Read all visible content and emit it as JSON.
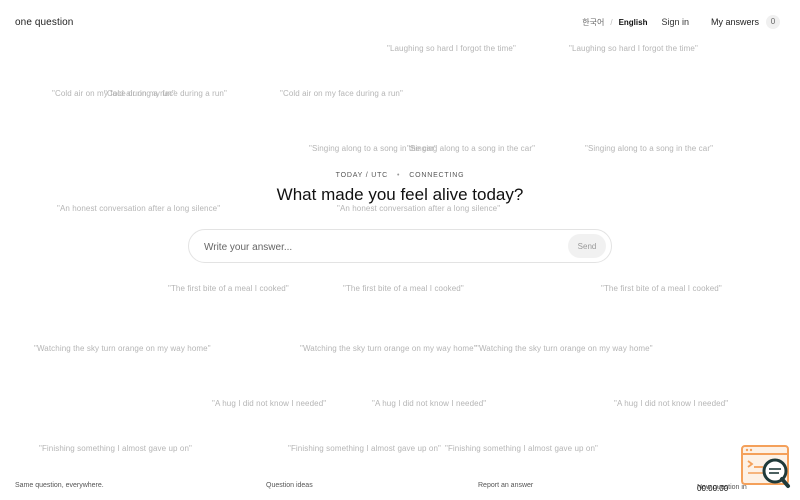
{
  "header": {
    "brand": "one question",
    "lang_alt": "한국어",
    "lang_current": "English",
    "sign_in": "Sign in",
    "my_answers": "My answers",
    "answers_count": "0"
  },
  "meta": {
    "date": "TODAY / UTC",
    "status": "CONNECTING"
  },
  "question": "What made you feel alive today?",
  "answer": {
    "placeholder": "Write your answer...",
    "send_label": "Send"
  },
  "floating_answers": [
    "\"Laughing so hard I forgot the time\"",
    "\"Laughing so hard I forgot the time\"",
    "\"Cold air on my face during a run\"",
    "\"Cold air on my face during a run\"",
    "\"Cold air on my face during a run\"",
    "\"Singing along to a song in the car\"",
    "\"Singing along to a song in the car\"",
    "\"Singing along to a song in the car\"",
    "\"An honest conversation after a long silence\"",
    "\"An honest conversation after a long silence\"",
    "\"The first bite of a meal I cooked\"",
    "\"The first bite of a meal I cooked\"",
    "\"The first bite of a meal I cooked\"",
    "\"Watching the sky turn orange on my way home\"",
    "\"Watching the sky turn orange on my way home\"",
    "\"Watching the sky turn orange on my way home\"",
    "\"A hug I did not know I needed\"",
    "\"A hug I did not know I needed\"",
    "\"A hug I did not know I needed\"",
    "\"Finishing something I almost gave up on\"",
    "\"Finishing something I almost gave up on\"",
    "\"Finishing something I almost gave up on\""
  ],
  "footer": {
    "tagline": "Same question, everywhere.",
    "ideas": "Question ideas",
    "report": "Report an answer",
    "next_question_label": "New question in",
    "timer": "00:00:00"
  },
  "icons": {
    "corner_widget": "browser-search-icon"
  },
  "colors": {
    "accent_orange": "#f4a05a",
    "widget_dark": "#1f3a3a",
    "floating_text": "#b5b5b5"
  }
}
